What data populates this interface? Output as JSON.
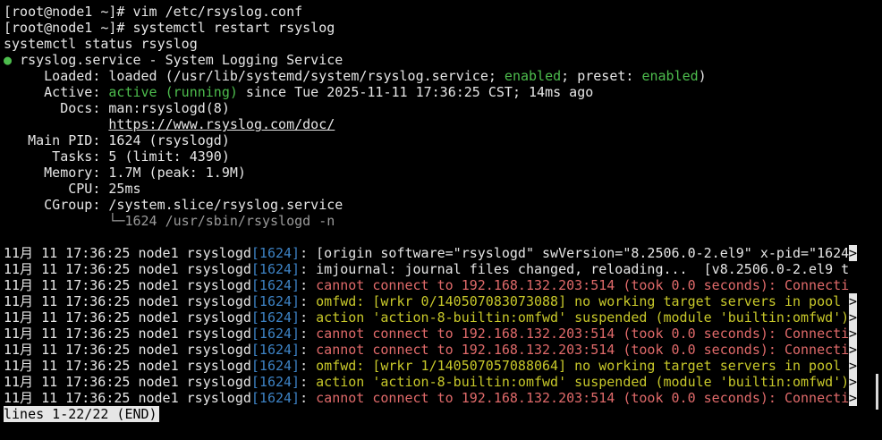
{
  "prompt_lines": [
    "[root@node1 ~]# vim /etc/rsyslog.conf",
    "[root@node1 ~]# systemctl restart rsyslog"
  ],
  "echo_line": "systemctl status rsyslog",
  "status": {
    "bullet": "●",
    "service_name": "rsyslog.service - System Logging Service",
    "loaded_label": "     Loaded: ",
    "loaded_pre": "loaded (/usr/lib/systemd/system/rsyslog.service; ",
    "loaded_enabled": "enabled",
    "loaded_mid": "; preset: ",
    "loaded_preset": "enabled",
    "loaded_post": ")",
    "active_label": "     Active: ",
    "active_state": "active (running)",
    "active_rest": " since Tue 2025-11-11 17:36:25 CST; 14ms ago",
    "docs_label": "       Docs: ",
    "docs_1": "man:rsyslogd(8)",
    "docs_indent": "             ",
    "docs_2": "https://www.rsyslog.com/doc/",
    "mainpid_label": "   Main PID: ",
    "mainpid": "1624 (rsyslogd)",
    "tasks_label": "      Tasks: ",
    "tasks": "5 (limit: 4390)",
    "memory_label": "     Memory: ",
    "memory": "1.7M (peak: 1.9M)",
    "cpu_label": "        CPU: ",
    "cpu": "25ms",
    "cgroup_label": "     CGroup: ",
    "cgroup": "/system.slice/rsyslog.service",
    "cgroup_indent": "             ",
    "cgroup_child": "└─1624 /usr/sbin/rsyslogd -n"
  },
  "log_prefix": "11月 11 17:36:25 node1 rsyslogd",
  "log_pid": "[1624]",
  "log_colon": ": ",
  "truncation_marker": ">",
  "logs": [
    {
      "level": "normal",
      "message": "[origin software=\"rsyslogd\" swVersion=\"8.2506.0-2.el9\" x-pid=\"1624",
      "truncated": true
    },
    {
      "level": "normal",
      "message": "imjournal: journal files changed, reloading...  [v8.2506.0-2.el9 t",
      "truncated": false
    },
    {
      "level": "error",
      "message": "cannot connect to 192.168.132.203:514 (took 0.0 seconds): Connecti",
      "truncated": false
    },
    {
      "level": "warn",
      "message": "omfwd: [wrkr 0/140507083073088] no working target servers in pool",
      "truncated": true
    },
    {
      "level": "warn",
      "message": "action 'action-8-builtin:omfwd' suspended (module 'builtin:omfwd')",
      "truncated": true
    },
    {
      "level": "error",
      "message": "cannot connect to 192.168.132.203:514 (took 0.0 seconds): Connecti",
      "truncated": true
    },
    {
      "level": "error",
      "message": "cannot connect to 192.168.132.203:514 (took 0.0 seconds): Connecti",
      "truncated": true
    },
    {
      "level": "warn",
      "message": "omfwd: [wrkr 1/140507057088064] no working target servers in pool",
      "truncated": true
    },
    {
      "level": "warn",
      "message": "action 'action-8-builtin:omfwd' suspended (module 'builtin:omfwd')",
      "truncated": true
    },
    {
      "level": "error",
      "message": "cannot connect to 192.168.132.203:514 (took 0.0 seconds): Connecti",
      "truncated": true
    }
  ],
  "pager_status": "lines 1-22/22 (END)",
  "colors": {
    "background": "#000000",
    "foreground": "#e6e6e6",
    "green": "#4dbd4d",
    "pid_blue": "#3d82c4",
    "error_red": "#e06a6a",
    "warn_yellow": "#c8c82a"
  }
}
